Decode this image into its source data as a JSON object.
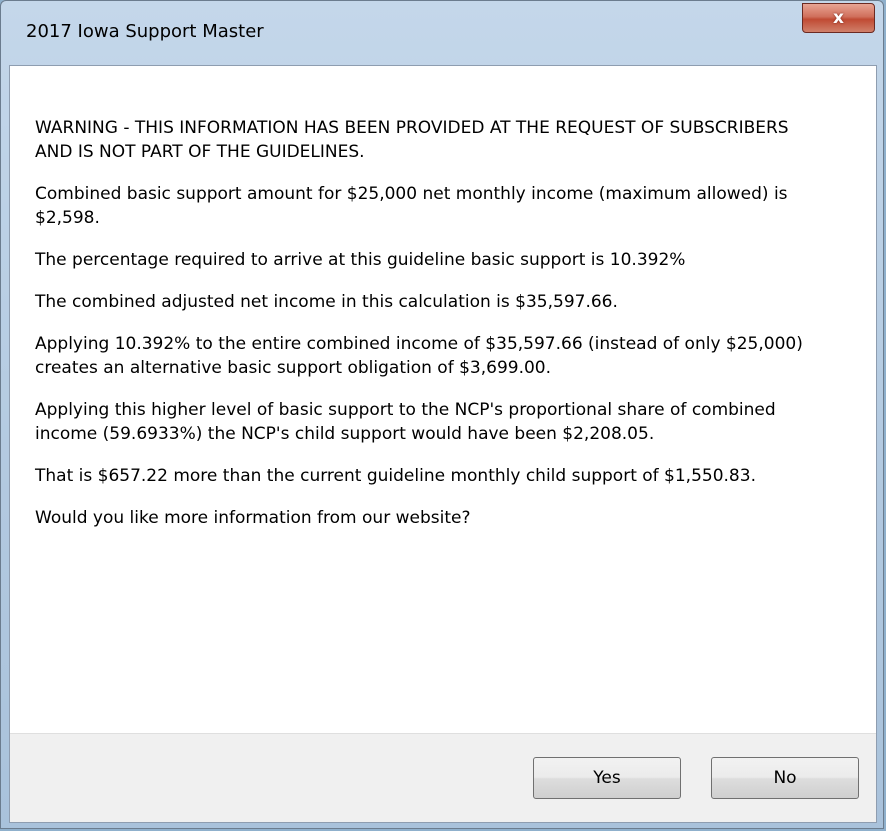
{
  "window": {
    "title": "2017 Iowa Support Master",
    "close_glyph": "x"
  },
  "message": {
    "paragraphs": [
      "WARNING - THIS INFORMATION HAS BEEN PROVIDED AT THE REQUEST OF SUBSCRIBERS AND IS NOT PART OF THE GUIDELINES.",
      "Combined basic support amount for $25,000 net monthly income (maximum allowed) is $2,598.",
      "The percentage required to arrive at this guideline basic support is 10.392%",
      "The combined adjusted net income in this calculation is $35,597.66.",
      "Applying 10.392% to the entire combined income of $35,597.66 (instead of only $25,000) creates an alternative basic support obligation of $3,699.00.",
      "Applying this higher level of basic support to the NCP's proportional share of combined income (59.6933%) the NCP's child support would have been $2,208.05.",
      "That is $657.22 more than the current guideline monthly child support of $1,550.83.",
      "Would you like more information from our website?"
    ]
  },
  "buttons": {
    "yes_label": "Yes",
    "no_label": "No"
  },
  "colors": {
    "close_button": "#c04a33",
    "title_bar": "#c4d7ea",
    "button_bar": "#f0f0f0"
  },
  "icons": {
    "close": "close-icon"
  }
}
